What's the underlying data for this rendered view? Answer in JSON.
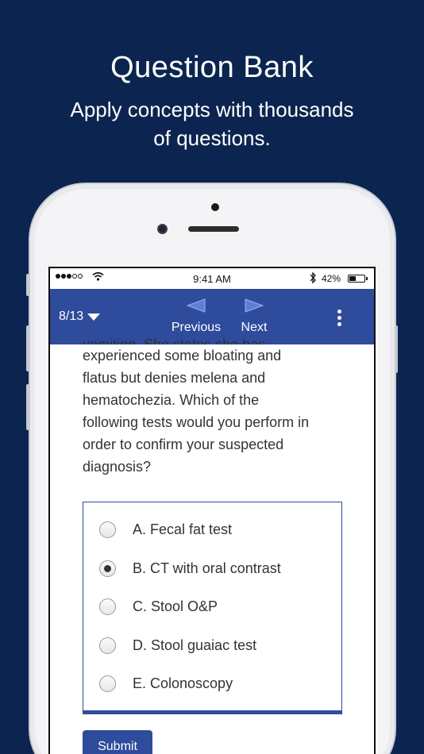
{
  "promo": {
    "title": "Question Bank",
    "subtitle_line1": "Apply concepts with thousands",
    "subtitle_line2": "of questions."
  },
  "status_bar": {
    "time": "9:41 AM",
    "battery": "42%",
    "battery_level": 0.42,
    "signal_bars_filled": 3,
    "signal_bars_total": 5,
    "icons": [
      "wifi-icon",
      "bluetooth-icon",
      "battery-icon"
    ]
  },
  "nav": {
    "counter": "8/13",
    "previous_label": "Previous",
    "next_label": "Next",
    "icons": [
      "chevron-down-icon",
      "left-arrow-icon",
      "right-arrow-icon",
      "more-vertical-icon"
    ]
  },
  "question": {
    "cut_line": "vomiting. She states she has",
    "lines": [
      "experienced some bloating and",
      "flatus but denies melena and",
      "hematochezia. Which of the",
      "following tests would you perform in",
      "order to confirm your suspected",
      "diagnosis?"
    ]
  },
  "answers": [
    {
      "label": "A. Fecal fat test",
      "selected": false
    },
    {
      "label": "B. CT with oral contrast",
      "selected": true
    },
    {
      "label": "C. Stool O&P",
      "selected": false
    },
    {
      "label": "D. Stool guaiac test",
      "selected": false
    },
    {
      "label": "E. Colonoscopy",
      "selected": false
    }
  ],
  "submit_label": "Submit",
  "colors": {
    "background": "#0c2550",
    "accent": "#2f4b9c"
  }
}
